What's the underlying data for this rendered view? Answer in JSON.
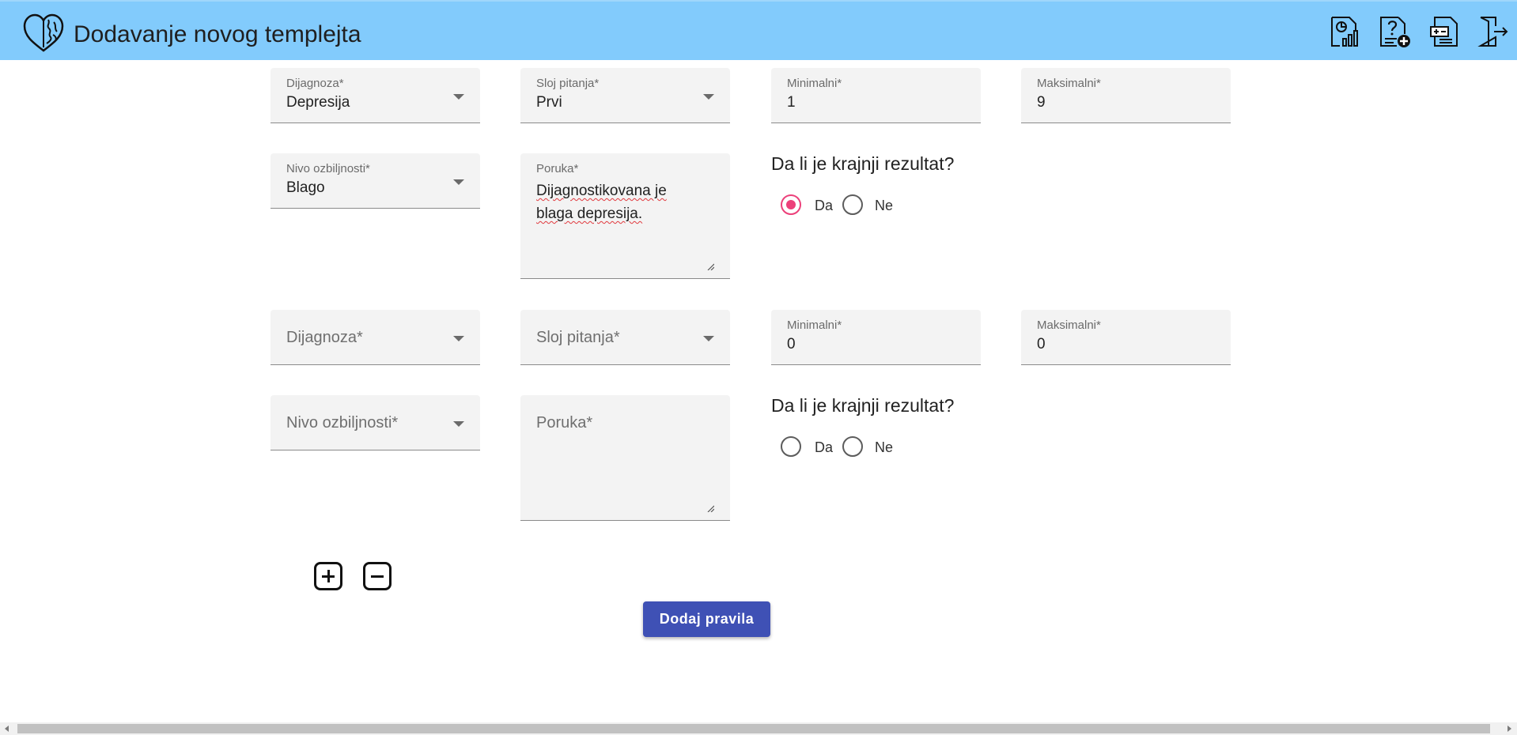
{
  "header": {
    "title": "Dodavanje novog templejta",
    "icons": [
      "brain-heart-logo-icon",
      "reports-chart-icon",
      "add-question-icon",
      "add-template-icon",
      "logout-icon"
    ],
    "background": "#82cbfc"
  },
  "rules": [
    {
      "diagnosis": {
        "label": "Dijagnoza*",
        "value": "Depresija"
      },
      "layer": {
        "label": "Sloj pitanja*",
        "value": "Prvi"
      },
      "min": {
        "label": "Minimalni*",
        "value": "1"
      },
      "max": {
        "label": "Maksimalni*",
        "value": "9"
      },
      "severity": {
        "label": "Nivo ozbiljnosti*",
        "value": "Blago"
      },
      "message": {
        "label": "Poruka*",
        "value_line1": "Dijagnostikovana je",
        "value_line2": "blaga depresija."
      },
      "final_question": "Da li je krajnji rezultat?",
      "options": {
        "yes": "Da",
        "no": "Ne",
        "selected": "Da"
      }
    },
    {
      "diagnosis": {
        "placeholder": "Dijagnoza*"
      },
      "layer": {
        "placeholder": "Sloj pitanja*"
      },
      "min": {
        "label": "Minimalni*",
        "value": "0"
      },
      "max": {
        "label": "Maksimalni*",
        "value": "0"
      },
      "severity": {
        "placeholder": "Nivo ozbiljnosti*"
      },
      "message": {
        "placeholder": "Poruka*"
      },
      "final_question": "Da li je krajnji rezultat?",
      "options": {
        "yes": "Da",
        "no": "Ne",
        "selected": null
      }
    }
  ],
  "actions": {
    "add_rule": "+",
    "remove_rule": "−",
    "submit_label": "Dodaj pravila"
  },
  "colors": {
    "accent_radio": "#ec407a",
    "primary_button": "#3f51b5"
  }
}
